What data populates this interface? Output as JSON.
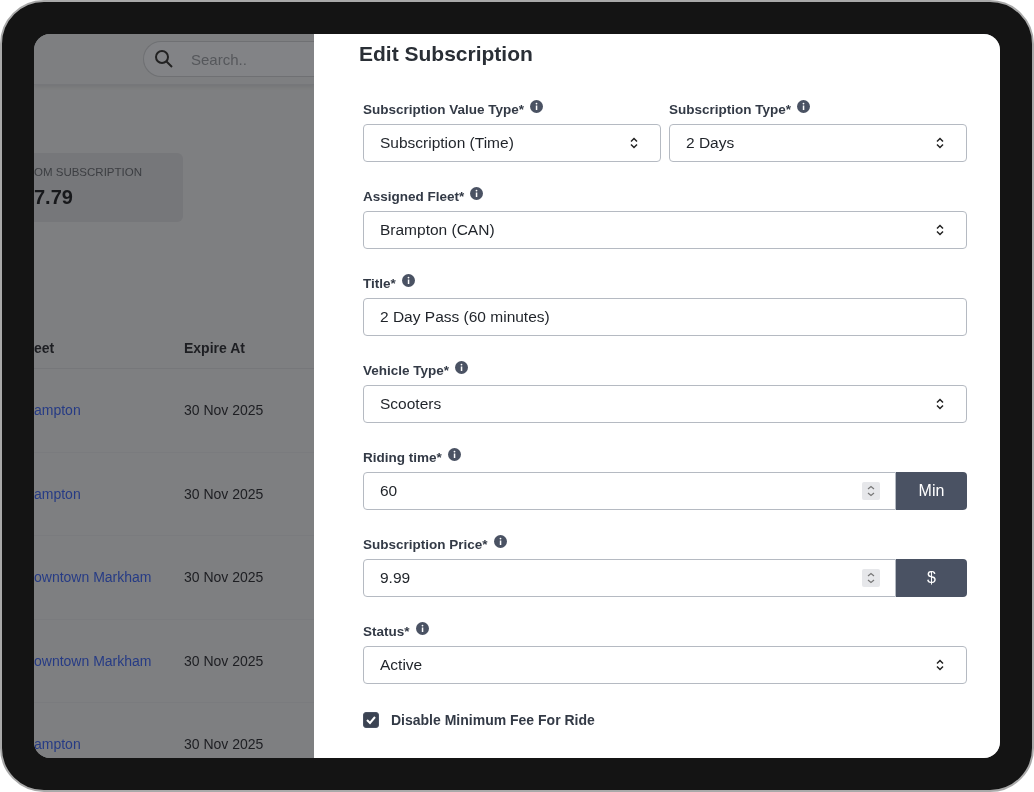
{
  "background": {
    "search": {
      "placeholder": "Search.."
    },
    "stat_card": {
      "label": "OM SUBSCRIPTION",
      "value": "7.79"
    },
    "table": {
      "columns": [
        "eet",
        "Expire At"
      ],
      "rows": [
        {
          "fleet": "ampton",
          "expire_at": "30 Nov 2025"
        },
        {
          "fleet": "ampton",
          "expire_at": "30 Nov 2025"
        },
        {
          "fleet": "owntown Markham",
          "expire_at": "30 Nov 2025"
        },
        {
          "fleet": "owntown Markham",
          "expire_at": "30 Nov 2025"
        },
        {
          "fleet": "ampton",
          "expire_at": "30 Nov 2025"
        }
      ]
    }
  },
  "drawer": {
    "title": "Edit Subscription",
    "rows": [
      [
        {
          "kind": "select",
          "label": "Subscription Value Type*",
          "value": "Subscription (Time)"
        },
        {
          "kind": "select",
          "label": "Subscription Type*",
          "value": "2 Days"
        }
      ],
      [
        {
          "kind": "select",
          "label": "Assigned Fleet*",
          "value": "Brampton (CAN)"
        }
      ],
      [
        {
          "kind": "text",
          "label": "Title*",
          "value": "2 Day Pass (60 minutes)"
        }
      ],
      [
        {
          "kind": "select",
          "label": "Vehicle Type*",
          "value": "Scooters"
        }
      ],
      [
        {
          "kind": "number",
          "label": "Riding time*",
          "value": "60",
          "unit": "Min"
        }
      ],
      [
        {
          "kind": "number",
          "label": "Subscription Price*",
          "value": "9.99",
          "unit": "$"
        }
      ],
      [
        {
          "kind": "select",
          "label": "Status*",
          "value": "Active"
        }
      ]
    ],
    "checkbox": {
      "label": "Disable Minimum Fee For Ride",
      "checked": true
    }
  }
}
